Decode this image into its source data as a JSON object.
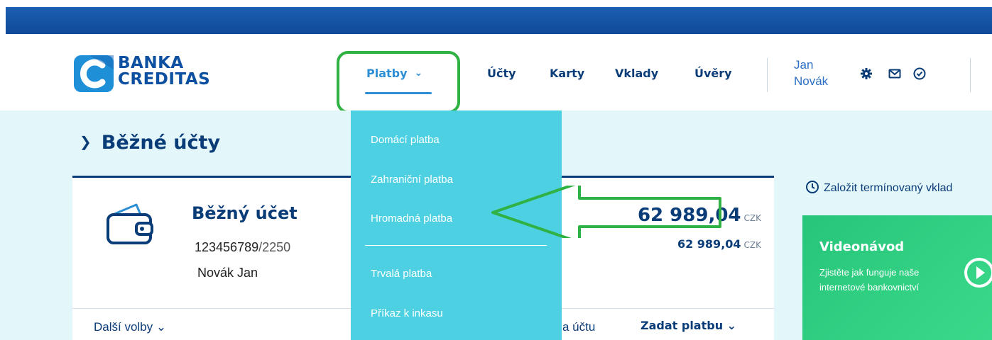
{
  "brand": {
    "line1": "BANKA",
    "line2": "CREDITAS"
  },
  "nav": {
    "platby": "Platby",
    "ucty": "Účty",
    "karty": "Karty",
    "vklady": "Vklady",
    "uvery": "Úvěry"
  },
  "user": {
    "first_name": "Jan",
    "last_name": "Novák"
  },
  "dropdown": {
    "items": [
      "Domácí platba",
      "Zahraniční platba",
      "Hromadná platba",
      "Trvalá platba",
      "Příkaz k inkasu"
    ]
  },
  "section": {
    "title": "Běžné účty"
  },
  "account": {
    "title": "Běžný účet",
    "number": "123456789",
    "bank_code": "/2250",
    "owner": "Novák Jan",
    "balance": "62 989,04",
    "available": "62 989,04",
    "currency": "CZK"
  },
  "actions": {
    "more_options": "Další volby",
    "partial_link": "a účtu",
    "enter_payment": "Zadat platbu"
  },
  "sidebar": {
    "term_deposit_link": "Založit termínovaný vklad",
    "video_title": "Videonávod",
    "video_description": "Zjistěte jak funguje naše internetové bankovnictví"
  },
  "colors": {
    "brand_blue": "#0d4fa0",
    "active_nav": "#2c8fd6",
    "dropdown_bg": "#4dd0e1",
    "video_card": "#27c57a",
    "annotation": "#2fb243"
  }
}
